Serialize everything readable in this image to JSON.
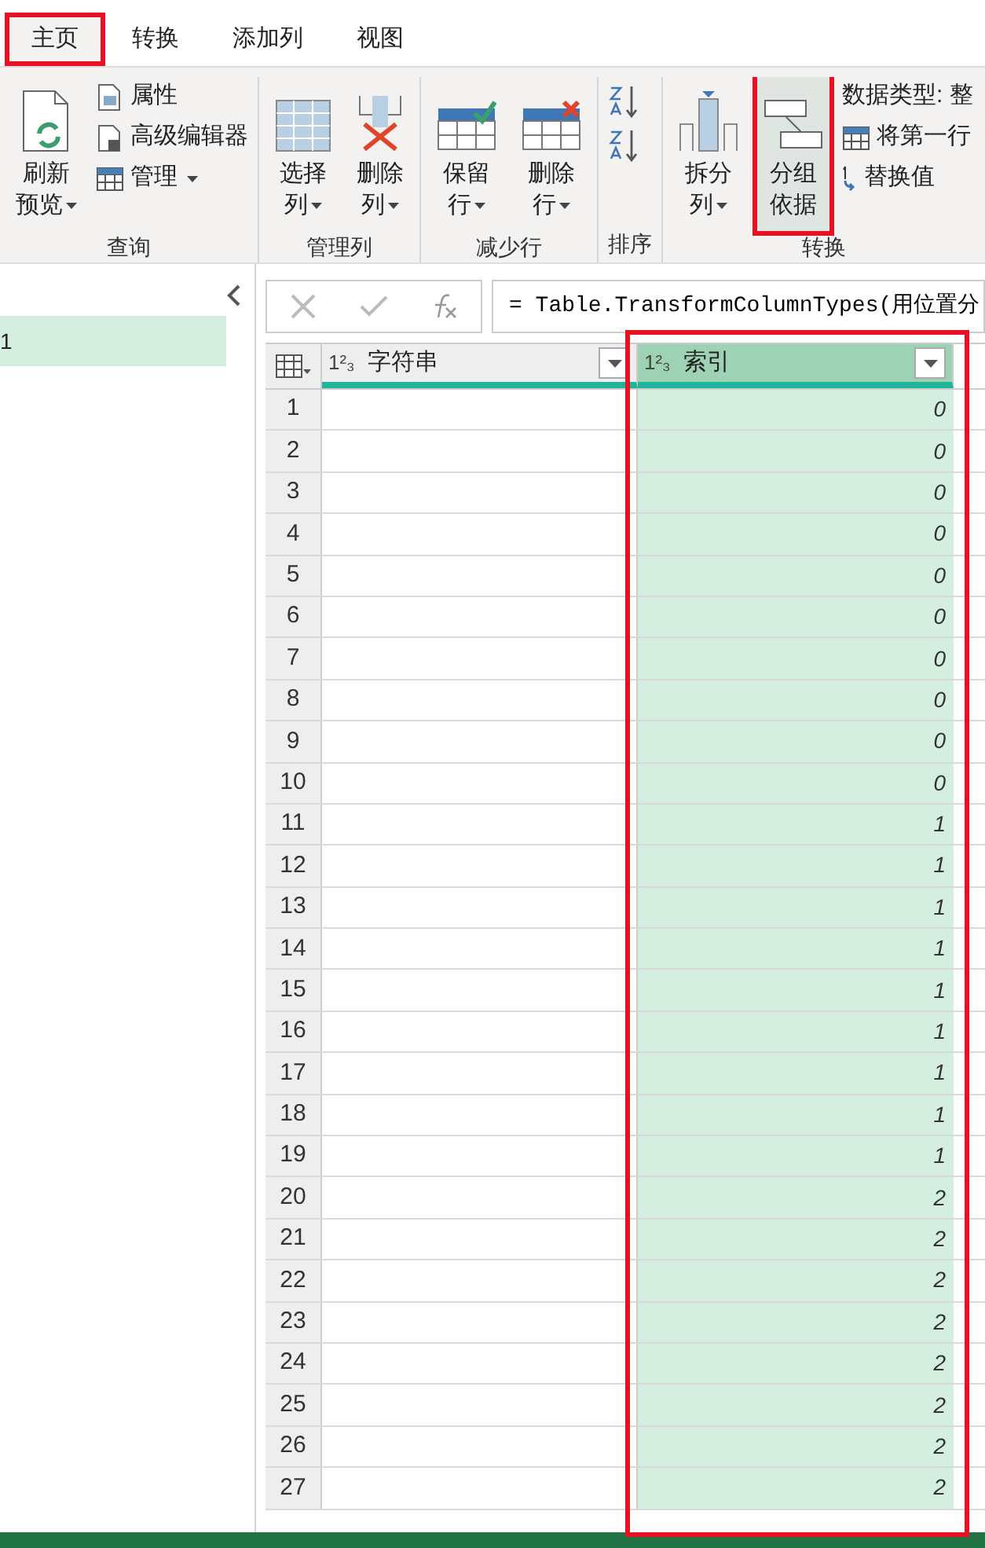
{
  "tabs": [
    {
      "label": "主页",
      "selected": true
    },
    {
      "label": "转换",
      "selected": false
    },
    {
      "label": "添加列",
      "selected": false
    },
    {
      "label": "视图",
      "selected": false
    }
  ],
  "ribbon": {
    "groups": [
      {
        "kind": "buttons",
        "label": "查询",
        "large": [
          {
            "lines": [
              "刷新",
              "预览"
            ],
            "dropdown": true,
            "highlighted": false
          }
        ],
        "small": [
          {
            "label": "属性",
            "dropdown": false
          },
          {
            "label": "高级编辑器",
            "dropdown": false
          },
          {
            "label": "管理",
            "dropdown": true
          }
        ]
      },
      {
        "kind": "buttons",
        "label": "管理列",
        "large": [
          {
            "lines": [
              "选择",
              "列"
            ],
            "dropdown": true,
            "highlighted": false
          },
          {
            "lines": [
              "删除",
              "列"
            ],
            "dropdown": true,
            "highlighted": false
          }
        ]
      },
      {
        "kind": "buttons",
        "label": "减少行",
        "large": [
          {
            "lines": [
              "保留",
              "行"
            ],
            "dropdown": true,
            "highlighted": false
          },
          {
            "lines": [
              "删除",
              "行"
            ],
            "dropdown": true,
            "highlighted": false
          }
        ]
      },
      {
        "kind": "sort",
        "label": "排序"
      },
      {
        "kind": "buttons",
        "label": "转换",
        "large": [
          {
            "lines": [
              "拆分",
              "列"
            ],
            "dropdown": true,
            "highlighted": false
          },
          {
            "lines": [
              "分组",
              "依据"
            ],
            "dropdown": false,
            "highlighted": true
          }
        ],
        "small": [
          {
            "label": "数据类型: 整",
            "dropdown": false
          },
          {
            "label": "将第一行",
            "dropdown": false
          },
          {
            "label": "替换值",
            "dropdown": false
          }
        ]
      }
    ]
  },
  "queries": [
    {
      "label": "1",
      "selected": true
    }
  ],
  "formula_bar": {
    "formula": "= Table.TransformColumnTypes(用位置分"
  },
  "table": {
    "columns": [
      {
        "type_label": "1²₃",
        "name": "字符串",
        "selected": false
      },
      {
        "type_label": "1²₃",
        "name": "索引",
        "selected": true
      }
    ],
    "rows": [
      {
        "n": "1",
        "v": "0"
      },
      {
        "n": "2",
        "v": "0"
      },
      {
        "n": "3",
        "v": "0"
      },
      {
        "n": "4",
        "v": "0"
      },
      {
        "n": "5",
        "v": "0"
      },
      {
        "n": "6",
        "v": "0"
      },
      {
        "n": "7",
        "v": "0"
      },
      {
        "n": "8",
        "v": "0"
      },
      {
        "n": "9",
        "v": "0"
      },
      {
        "n": "10",
        "v": "0"
      },
      {
        "n": "11",
        "v": "1"
      },
      {
        "n": "12",
        "v": "1"
      },
      {
        "n": "13",
        "v": "1"
      },
      {
        "n": "14",
        "v": "1"
      },
      {
        "n": "15",
        "v": "1"
      },
      {
        "n": "16",
        "v": "1"
      },
      {
        "n": "17",
        "v": "1"
      },
      {
        "n": "18",
        "v": "1"
      },
      {
        "n": "19",
        "v": "1"
      },
      {
        "n": "20",
        "v": "2"
      },
      {
        "n": "21",
        "v": "2"
      },
      {
        "n": "22",
        "v": "2"
      },
      {
        "n": "23",
        "v": "2"
      },
      {
        "n": "24",
        "v": "2"
      },
      {
        "n": "25",
        "v": "2"
      },
      {
        "n": "26",
        "v": "2"
      },
      {
        "n": "27",
        "v": "2"
      }
    ]
  }
}
